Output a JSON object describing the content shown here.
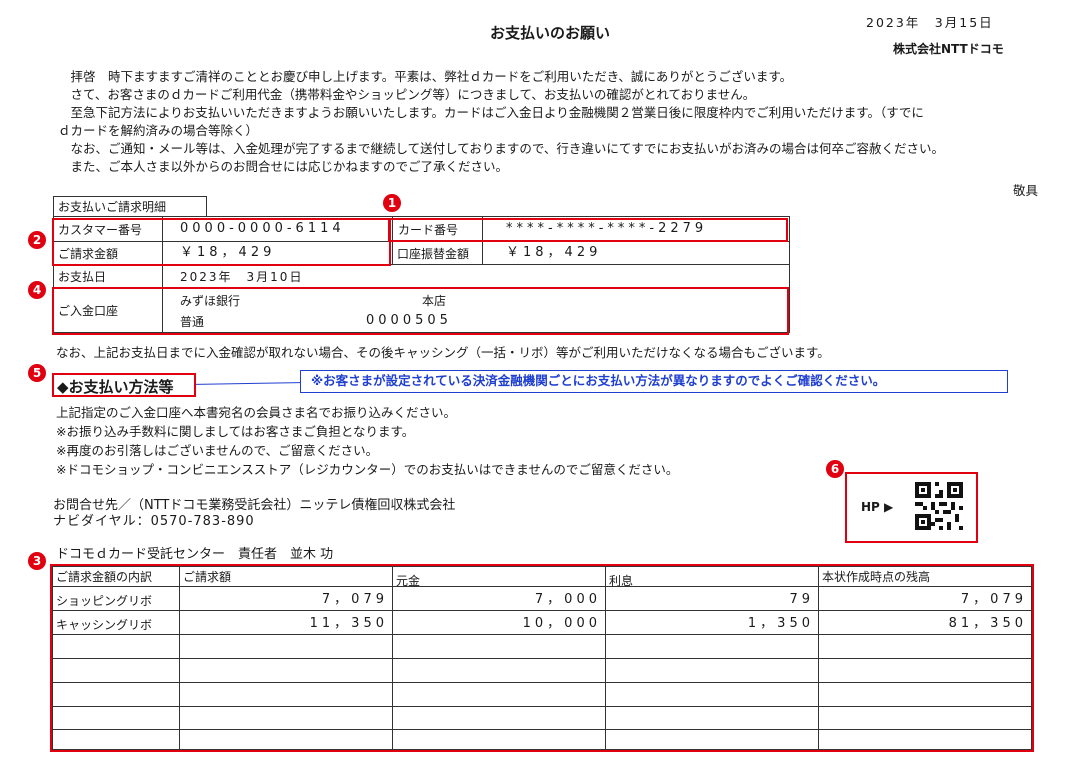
{
  "header": {
    "title": "お支払いのお願い",
    "date": "2023年　3月15日",
    "company": "株式会社NTTドコモ"
  },
  "body": {
    "lines": [
      "　拝啓　時下ますますご清祥のこととお慶び申し上げます。平素は、弊社ｄカードをご利用いただき、誠にありがとうございます。",
      "　さて、お客さまのｄカードご利用代金（携帯料金やショッピング等）につきまして、お支払いの確認がとれておりません。",
      "　至急下記方法によりお支払いいただきますようお願いいたします。カードはご入金日より金融機関２営業日後に限度枠内でご利用いただけます。（すでに",
      "ｄカードを解約済みの場合等除く）",
      "　なお、ご通知・メール等は、入金処理が完了するまで継続して送付しておりますので、行き違いにてすでにお支払いがお済みの場合は何卒ご容赦ください。",
      "　また、ご本人さま以外からのお問合せには応じかねますのでご了承ください。"
    ],
    "closing": "敬具"
  },
  "detail": {
    "tab_label": "お支払いご請求明細",
    "customer_label": "カスタマー番号",
    "customer_value": "0000-0000-6114",
    "card_label": "カード番号",
    "card_value": "****-****-****-2279",
    "billing_label": "ご請求金額",
    "billing_value": "￥18，429",
    "transfer_label": "口座振替金額",
    "transfer_value": "￥18，429",
    "due_label": "お支払日",
    "due_value": "2023年　3月10日",
    "account_label": "ご入金口座",
    "bank_name": "みずほ銀行",
    "branch": "本店",
    "account_type": "普通",
    "account_number": "0000505"
  },
  "notice": "なお、上記お支払日までに入金確認が取れない場合、その後キャッシング（一括・リボ）等がご利用いただけなくなる場合もございます。",
  "method": {
    "heading": "◆お支払い方法等",
    "note": "※お客さまが設定されている決済金融機関ごとにお支払い方法が異なりますのでよくご確認ください。",
    "lines": [
      "上記指定のご入金口座へ本書宛名の会員さま名でお振り込みください。",
      "※お振り込み手数料に関しましてはお客さまご負担となります。",
      "※再度のお引落しはございませんので、ご留意ください。",
      "※ドコモショップ・コンビニエンスストア（レジカウンター）でのお支払いはできませんのでご留意ください。"
    ]
  },
  "contact": {
    "line1": "お問合せ先／（NTTドコモ業務受託会社）ニッテレ債権回収株式会社",
    "line2": "ナビダイヤル：0570-783-890",
    "center": "ドコモｄカード受託センター　責任者　並木 功",
    "hp_label": "HP ▶"
  },
  "badges": {
    "b1": "1",
    "b2": "2",
    "b3": "3",
    "b4": "4",
    "b5": "5",
    "b6": "6"
  },
  "breakdown": {
    "headers": [
      "ご請求金額の内訳",
      "ご請求額",
      "元金",
      "利息",
      "本状作成時点の残高"
    ],
    "rows": [
      {
        "name": "ショッピングリボ",
        "billed": "7，079",
        "principal": "7，000",
        "interest": "79",
        "balance": "7，079"
      },
      {
        "name": "キャッシングリボ",
        "billed": "11，350",
        "principal": "10，000",
        "interest": "1，350",
        "balance": "81，350"
      }
    ]
  },
  "colors": {
    "highlight_red": "#e00010",
    "note_blue": "#1f3fd0"
  }
}
